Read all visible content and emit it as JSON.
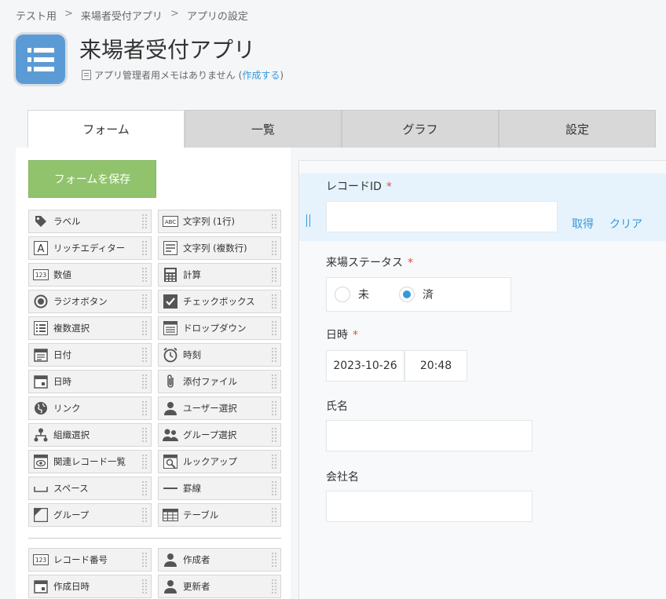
{
  "breadcrumb": {
    "items": [
      "テスト用",
      "来場者受付アプリ",
      "アプリの設定"
    ],
    "separator": ">"
  },
  "app": {
    "title": "来場者受付アプリ",
    "memo_text": "アプリ管理者用メモはありません",
    "memo_link": "作成する",
    "icon": "list-icon",
    "icon_color": "#5b9bd5"
  },
  "tabs": [
    {
      "label": "フォーム",
      "active": true
    },
    {
      "label": "一覧",
      "active": false
    },
    {
      "label": "グラフ",
      "active": false
    },
    {
      "label": "設定",
      "active": false
    }
  ],
  "save_button": {
    "label": "フォームを保存",
    "color": "#91c36c"
  },
  "palette": [
    {
      "label": "ラベル",
      "icon": "tag-icon"
    },
    {
      "label": "文字列 (1行)",
      "icon": "abc-icon"
    },
    {
      "label": "リッチエディター",
      "icon": "rich-editor-icon"
    },
    {
      "label": "文字列 (複数行)",
      "icon": "multiline-icon"
    },
    {
      "label": "数値",
      "icon": "number-icon"
    },
    {
      "label": "計算",
      "icon": "calculator-icon"
    },
    {
      "label": "ラジオボタン",
      "icon": "radio-icon"
    },
    {
      "label": "チェックボックス",
      "icon": "checkbox-icon"
    },
    {
      "label": "複数選択",
      "icon": "multi-select-icon"
    },
    {
      "label": "ドロップダウン",
      "icon": "dropdown-icon"
    },
    {
      "label": "日付",
      "icon": "date-icon"
    },
    {
      "label": "時刻",
      "icon": "clock-icon"
    },
    {
      "label": "日時",
      "icon": "datetime-icon"
    },
    {
      "label": "添付ファイル",
      "icon": "paperclip-icon"
    },
    {
      "label": "リンク",
      "icon": "globe-icon"
    },
    {
      "label": "ユーザー選択",
      "icon": "user-icon"
    },
    {
      "label": "組織選択",
      "icon": "org-icon"
    },
    {
      "label": "グループ選択",
      "icon": "group-icon"
    },
    {
      "label": "関連レコード一覧",
      "icon": "related-records-icon"
    },
    {
      "label": "ルックアップ",
      "icon": "lookup-icon"
    },
    {
      "label": "スペース",
      "icon": "space-icon"
    },
    {
      "label": "罫線",
      "icon": "line-icon"
    },
    {
      "label": "グループ",
      "icon": "group-field-icon"
    },
    {
      "label": "テーブル",
      "icon": "table-icon"
    }
  ],
  "system_palette": [
    {
      "label": "レコード番号",
      "icon": "number-icon"
    },
    {
      "label": "作成者",
      "icon": "user-icon"
    },
    {
      "label": "作成日時",
      "icon": "datetime-icon"
    },
    {
      "label": "更新者",
      "icon": "user-icon"
    }
  ],
  "form": {
    "record_id": {
      "label": "レコードID",
      "required": "*",
      "value": "",
      "lookup_label": "取得",
      "clear_label": "クリア"
    },
    "status": {
      "label": "来場ステータス",
      "required": "*",
      "options": [
        "未",
        "済"
      ],
      "selected": "済"
    },
    "datetime": {
      "label": "日時",
      "required": "*",
      "date": "2023-10-26",
      "time": "20:48"
    },
    "name": {
      "label": "氏名",
      "value": ""
    },
    "company": {
      "label": "会社名",
      "value": ""
    }
  }
}
